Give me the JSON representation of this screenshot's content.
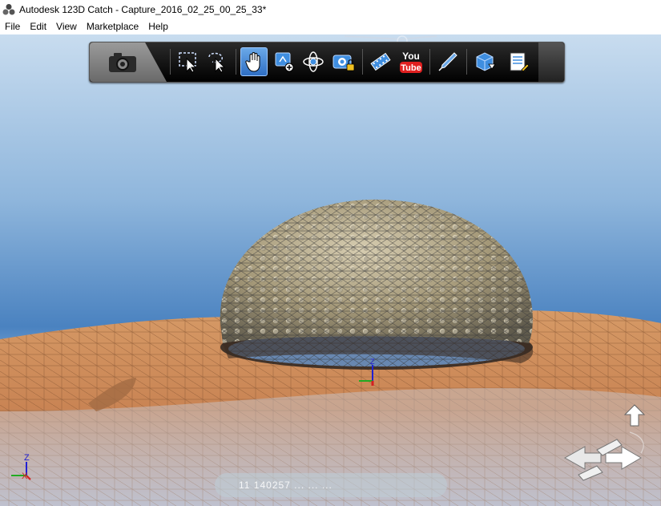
{
  "window": {
    "title": "Autodesk 123D Catch - Capture_2016_02_25_00_25_33*",
    "app_icon": "autodesk-123d-catch-icon"
  },
  "menubar": {
    "items": [
      {
        "label": "File"
      },
      {
        "label": "Edit"
      },
      {
        "label": "View"
      },
      {
        "label": "Marketplace"
      },
      {
        "label": "Help"
      }
    ]
  },
  "toolbar": {
    "camera_tab_icon": "camera-icon",
    "tools": [
      {
        "name": "rectangle-select-icon"
      },
      {
        "name": "lasso-select-icon"
      },
      {
        "name": "pan-hand-icon",
        "active": true
      },
      {
        "name": "zoom-icon"
      },
      {
        "name": "orbit-icon"
      },
      {
        "name": "locked-camera-icon"
      },
      {
        "name": "film-strip-icon"
      },
      {
        "name": "youtube-icon",
        "label_top": "You",
        "label_bottom": "Tube"
      },
      {
        "name": "pen-tool-icon"
      },
      {
        "name": "export-mesh-icon"
      },
      {
        "name": "notes-icon"
      }
    ]
  },
  "viewport": {
    "sky_top": "#b7cfe6",
    "sky_mid": "#4f86c2",
    "ground_color": "#c98a58",
    "axis_colors": {
      "x": "#d42020",
      "y": "#22aa22",
      "z": "#2020d4"
    },
    "axis_labels": {
      "x": "X",
      "z": "Z"
    },
    "status_text": "11 140257 ... ... ..."
  }
}
